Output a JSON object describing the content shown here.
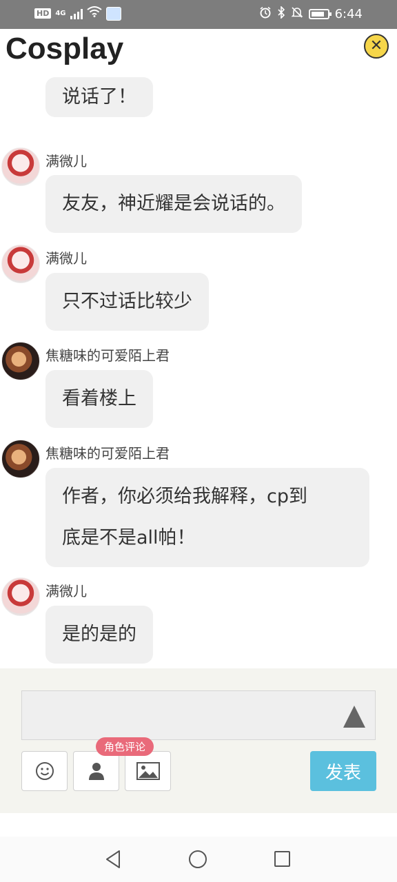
{
  "status_bar": {
    "left_chip": "HD",
    "network": "4G",
    "time": "6:44"
  },
  "header": {
    "title": "Cosplay"
  },
  "messages": [
    {
      "user": "",
      "text": "说话了！",
      "avatar": "green-character"
    },
    {
      "user": "满微儿",
      "text": "友友，神近耀是会说话的。",
      "avatar": "girl-red"
    },
    {
      "user": "满微儿",
      "text": "只不过话比较少",
      "avatar": "girl-red"
    },
    {
      "user": "焦糖味的可爱陌上君",
      "text": "看着楼上",
      "avatar": "boy-brown"
    },
    {
      "user": "焦糖味的可爱陌上君",
      "text_line1": "作者，你必须给我解释，cp到",
      "text_line2": "底是不是all帕！",
      "avatar": "boy-brown"
    },
    {
      "user": "满微儿",
      "text": "是的是的",
      "avatar": "girl-red"
    }
  ],
  "composer": {
    "input_value": "",
    "badge": "角色评论",
    "publish_label": "发表"
  },
  "colors": {
    "publish_button": "#5bc0de",
    "badge": "#e96a7a",
    "close_button": "#f6d64a"
  }
}
